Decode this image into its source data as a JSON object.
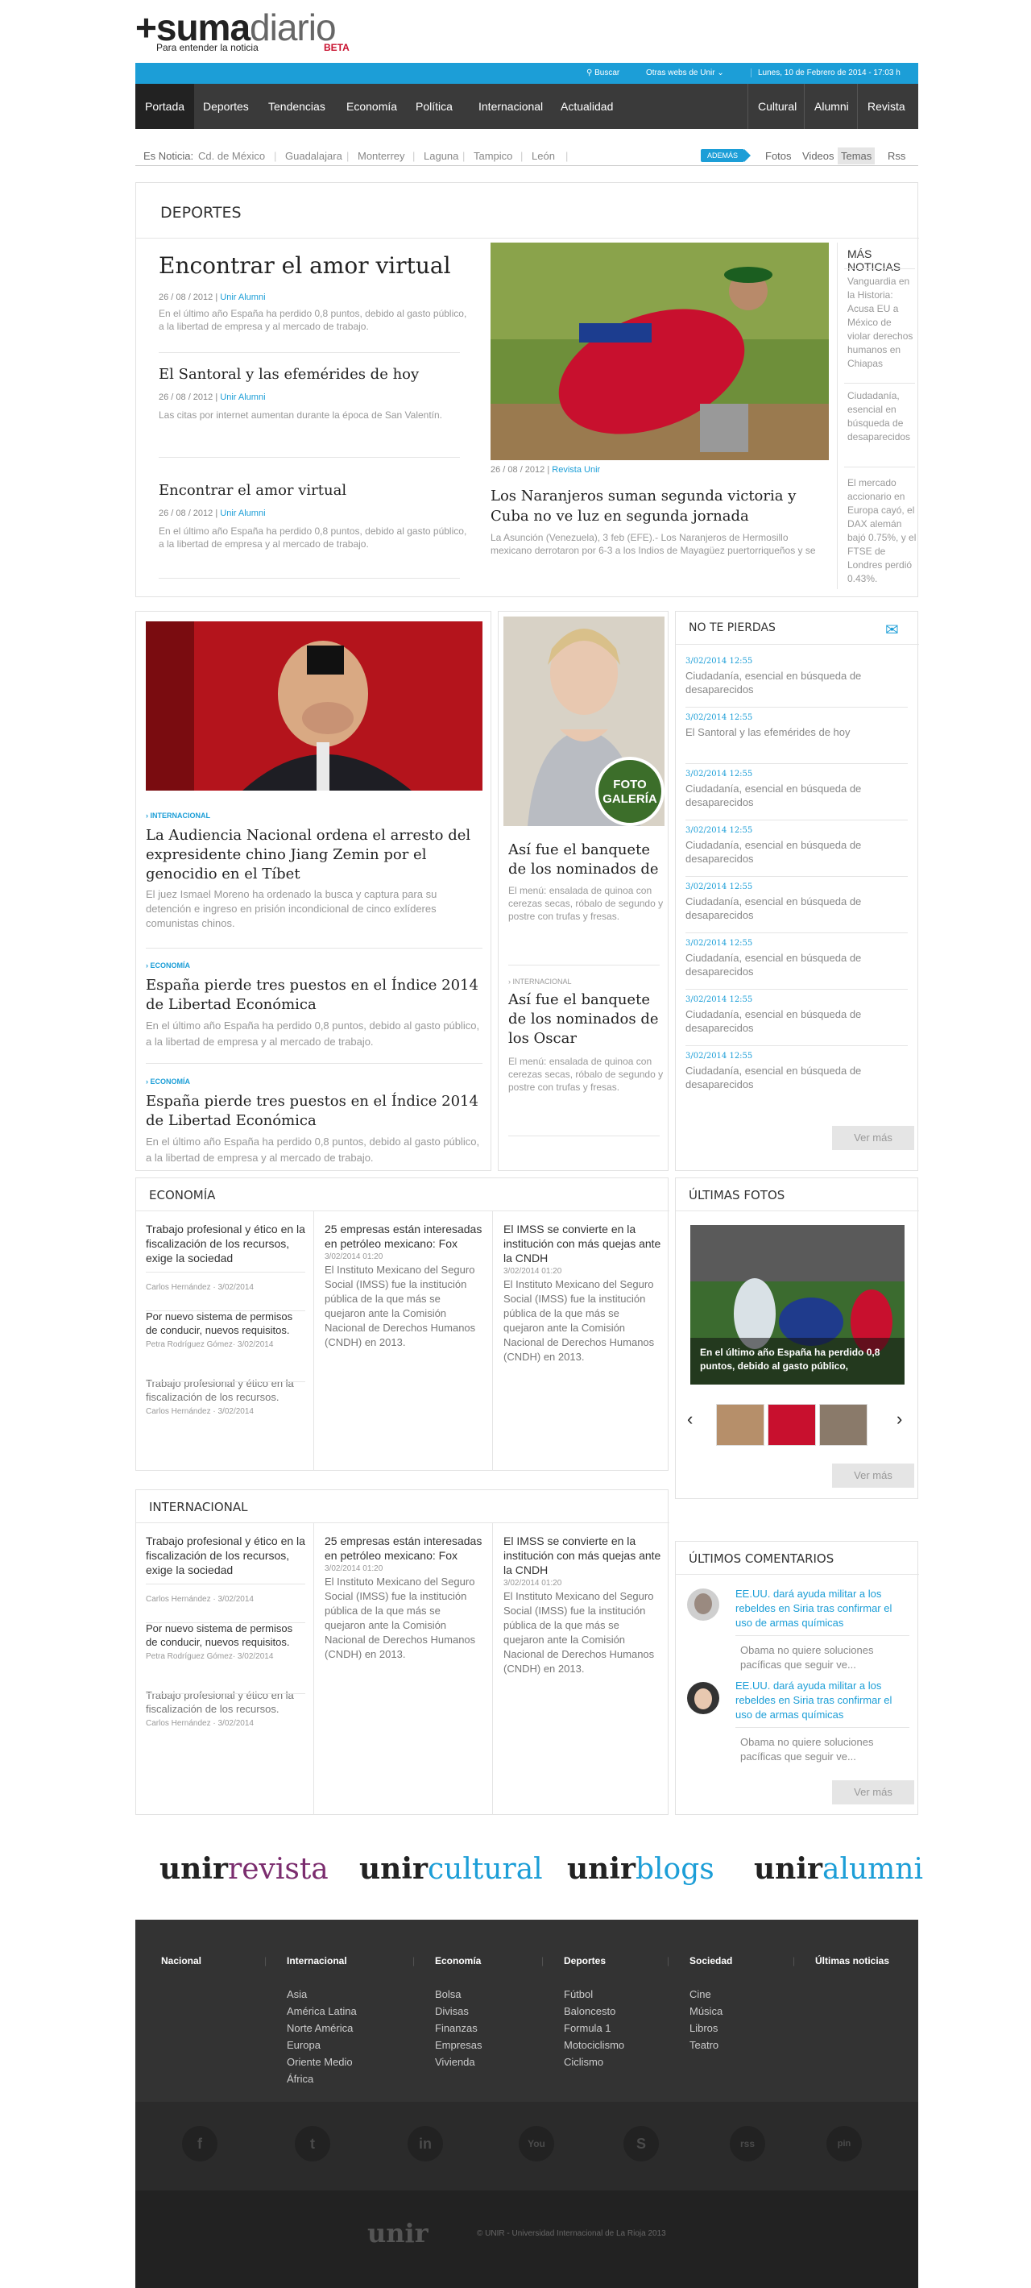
{
  "header": {
    "logo_prefix": "+suma",
    "logo_suffix": "diario",
    "tagline": "Para entender la noticia",
    "beta": "BETA",
    "search": "Buscar",
    "other_sites": "Otras webs de Unir",
    "date": "Lunes, 10 de Febrero de 2014 - 17:03 h"
  },
  "nav": {
    "left": [
      "Portada",
      "Deportes",
      "Tendencias",
      "Economía",
      "Política",
      "Internacional",
      "Actualidad"
    ],
    "right": [
      "Cultural",
      "Alumni",
      "Revista"
    ]
  },
  "ticker": {
    "label": "Es Noticia:",
    "cities": [
      "Cd. de México",
      "Guadalajara",
      "Monterrey",
      "Laguna",
      "Tampico",
      "León"
    ],
    "badge": "ADEMÁS",
    "links": [
      "Fotos",
      "Videos",
      "Temas",
      "Rss"
    ]
  },
  "deportes": {
    "title": "DEPORTES",
    "lead": {
      "title": "Encontrar el amor virtual",
      "date": "26 / 08 / 2012 |",
      "source": "Unir Alumni",
      "excerpt": "En el último año España ha perdido 0,8 puntos, debido al gasto público, a la libertad de empresa y al mercado de trabajo."
    },
    "second": {
      "title": "El Santoral y las efemérides de hoy",
      "date": "26 / 08 / 2012 |",
      "source": "Unir Alumni",
      "excerpt": "Las citas por internet aumentan durante la época de San Valentín."
    },
    "third": {
      "title": "Encontrar el amor virtual",
      "date": "26 / 08 / 2012 |",
      "source": "Unir Alumni",
      "excerpt": "En el último año España ha perdido 0,8 puntos, debido al gasto público, a la libertad de empresa y al mercado de trabajo."
    },
    "photo_story": {
      "date": "26 / 08 / 2012 |",
      "source": "Revista Unir",
      "title": "Los Naranjeros suman segunda victoria y Cuba no ve luz en segunda jornada",
      "excerpt": "La Asunción (Venezuela), 3 feb (EFE).- Los Naranjeros de Hermosillo mexicano derrotaron por 6-3 a los Indios de Mayagüez puertorriqueños y se situaron en la cima de la clasificación de"
    },
    "more_title": "MÁS NOTICIAS",
    "more": [
      "Vanguardia en la Historia: Acusa EU a México de violar derechos humanos en Chiapas",
      "Ciudadanía, esencial en búsqueda de desaparecidos",
      "El mercado accionario en Europa cayó, el DAX alemán bajó 0.75%, y el FTSE de Londres perdió 0.43%."
    ]
  },
  "feature": {
    "items": [
      {
        "kicker": "INTERNACIONAL",
        "title": "La Audiencia Nacional ordena el arresto del expresidente chino Jiang Zemin por el genocidio en el Tíbet",
        "excerpt": "El juez Ismael Moreno ha ordenado la busca y captura para su detención e ingreso en prisión incondicional de cinco exlíderes comunistas chinos."
      },
      {
        "kicker": "ECONOMÍA",
        "title": "España pierde tres puestos en el Índice 2014 de Libertad Económica",
        "excerpt": "En el último año España ha perdido 0,8 puntos, debido al gasto público, a la libertad de empresa y al mercado de trabajo."
      },
      {
        "kicker": "ECONOMÍA",
        "title": "España pierde tres puestos en el Índice 2014 de Libertad Económica",
        "excerpt": "En el último año España ha perdido 0,8 puntos, debido al gasto público, a la libertad de empresa y al mercado de trabajo."
      }
    ]
  },
  "gallery": {
    "badge_1": "FOTO",
    "badge_2": "GALERÍA",
    "item1": {
      "title": "Así fue el banquete de los nominados de",
      "excerpt": "El menú: ensalada de quinoa con cerezas secas, róbalo de segundo y postre con trufas y fresas."
    },
    "item2": {
      "kicker": "INTERNACIONAL",
      "title": "Así fue el banquete de los nominados de los Oscar",
      "excerpt": "El menú: ensalada de quinoa con cerezas secas, róbalo de segundo y postre con trufas y fresas."
    }
  },
  "no_te_pierdas": {
    "title": "NO TE PIERDAS",
    "items": [
      {
        "date": "3/02/2014 12:55",
        "text": "Ciudadanía, esencial en búsqueda de desaparecidos"
      },
      {
        "date": "3/02/2014 12:55",
        "text": "El Santoral y las efemérides de hoy"
      },
      {
        "date": "3/02/2014 12:55",
        "text": "Ciudadanía, esencial en búsqueda de desaparecidos"
      },
      {
        "date": "3/02/2014 12:55",
        "text": "Ciudadanía, esencial en búsqueda de desaparecidos"
      },
      {
        "date": "3/02/2014 12:55",
        "text": "Ciudadanía, esencial en búsqueda de desaparecidos"
      },
      {
        "date": "3/02/2014 12:55",
        "text": "Ciudadanía, esencial en búsqueda de desaparecidos"
      },
      {
        "date": "3/02/2014 12:55",
        "text": "Ciudadanía, esencial en búsqueda de desaparecidos"
      },
      {
        "date": "3/02/2014 12:55",
        "text": "Ciudadanía, esencial en búsqueda de desaparecidos"
      }
    ],
    "more": "Ver más"
  },
  "economia": {
    "title": "ECONOMÍA",
    "col1": [
      {
        "title": "Trabajo profesional y ético en la fiscalización de los recursos, exige la sociedad",
        "author": "Carlos Hernández · 3/02/2014"
      },
      {
        "title": "Por nuevo sistema de permisos de conducir, nuevos requisitos.",
        "author": "Petra Rodríguez Gómez· 3/02/2014"
      },
      {
        "title": "Trabajo profesional y ético en la fiscalización de los recursos.",
        "author": "Carlos Hernández · 3/02/2014"
      }
    ],
    "col2": {
      "title": "25 empresas están interesadas en petróleo mexicano: Fox",
      "date": "3/02/2014 01:20",
      "body": "El Instituto Mexicano del Seguro Social (IMSS) fue la institución pública de la que más se quejaron ante la Comisión Nacional de Derechos Humanos (CNDH) en 2013."
    },
    "col3": {
      "title": "El IMSS se convierte en la institución con más quejas ante la CNDH",
      "date": "3/02/2014 01:20",
      "body": "El Instituto Mexicano del Seguro Social (IMSS) fue la institución pública de la que más se quejaron ante la Comisión Nacional de Derechos Humanos (CNDH) en 2013."
    }
  },
  "internacional": {
    "title": "INTERNACIONAL",
    "col1": [
      {
        "title": "Trabajo profesional y ético en la fiscalización de los recursos, exige la sociedad",
        "author": "Carlos Hernández · 3/02/2014"
      },
      {
        "title": "Por nuevo sistema de permisos de conducir, nuevos requisitos.",
        "author": "Petra Rodríguez Gómez· 3/02/2014"
      },
      {
        "title": "Trabajo profesional y ético en la fiscalización de los recursos.",
        "author": "Carlos Hernández · 3/02/2014"
      }
    ],
    "col2": {
      "title": "25 empresas están interesadas en petróleo mexicano: Fox",
      "date": "3/02/2014 01:20",
      "body": "El Instituto Mexicano del Seguro Social (IMSS) fue la institución pública de la que más se quejaron ante la Comisión Nacional de Derechos Humanos (CNDH) en 2013."
    },
    "col3": {
      "title": "El IMSS se convierte en la institución con más quejas ante la CNDH",
      "date": "3/02/2014 01:20",
      "body": "El Instituto Mexicano del Seguro Social (IMSS) fue la institución pública de la que más se quejaron ante la Comisión Nacional de Derechos Humanos (CNDH) en 2013."
    }
  },
  "fotos": {
    "title": "ÚLTIMAS FOTOS",
    "caption": "En el último año España ha perdido 0,8 puntos, debido al gasto público,",
    "prev": "‹",
    "next": "›",
    "more": "Ver más"
  },
  "comentarios": {
    "title": "ÚLTIMOS COMENTARIOS",
    "items": [
      {
        "link": "EE.UU. dará ayuda militar a los rebeldes en Siria tras confirmar el uso de armas químicas",
        "text": "Obama no quiere soluciones pacíficas que seguir ve..."
      },
      {
        "link": "EE.UU. dará ayuda militar a los rebeldes en Siria tras confirmar el uso de armas químicas",
        "text": "Obama no quiere soluciones pacíficas que seguir ve..."
      }
    ],
    "more": "Ver más"
  },
  "brands": [
    {
      "a": "unir",
      "b": "revista",
      "color": "#7b2d6e"
    },
    {
      "a": "unir",
      "b": "cultural",
      "color": "#1c9ed7"
    },
    {
      "a": "unir",
      "b": "blogs",
      "color": "#1c9ed7"
    },
    {
      "a": "unir",
      "b": "alumni",
      "color": "#1c9ed7"
    }
  ],
  "footer": {
    "cols": [
      {
        "title": "Nacional",
        "links": []
      },
      {
        "title": "Internacional",
        "links": [
          "Asia",
          "América Latina",
          "Norte América",
          "Europa",
          "Oriente Medio",
          "África"
        ]
      },
      {
        "title": "Economía",
        "links": [
          "Bolsa",
          "Divisas",
          "Finanzas",
          "Empresas",
          "Vivienda"
        ]
      },
      {
        "title": "Deportes",
        "links": [
          "Fútbol",
          "Baloncesto",
          "Formula 1",
          "Motociclismo",
          "Ciclismo"
        ]
      },
      {
        "title": "Sociedad",
        "links": [
          "Cine",
          "Música",
          "Libros",
          "Teatro"
        ]
      },
      {
        "title": "Últimas noticias",
        "links": []
      }
    ],
    "social": [
      "f",
      "t",
      "in",
      "You",
      "S",
      "rss",
      "pin"
    ],
    "logo": "unir",
    "copyright": "© UNIR - Universidad Internacional de La Rioja 2013"
  },
  "colors": {
    "accent": "#1c9ed7",
    "nav": "#3a3a3a",
    "footer": "#333333",
    "beta": "#c8102e"
  }
}
